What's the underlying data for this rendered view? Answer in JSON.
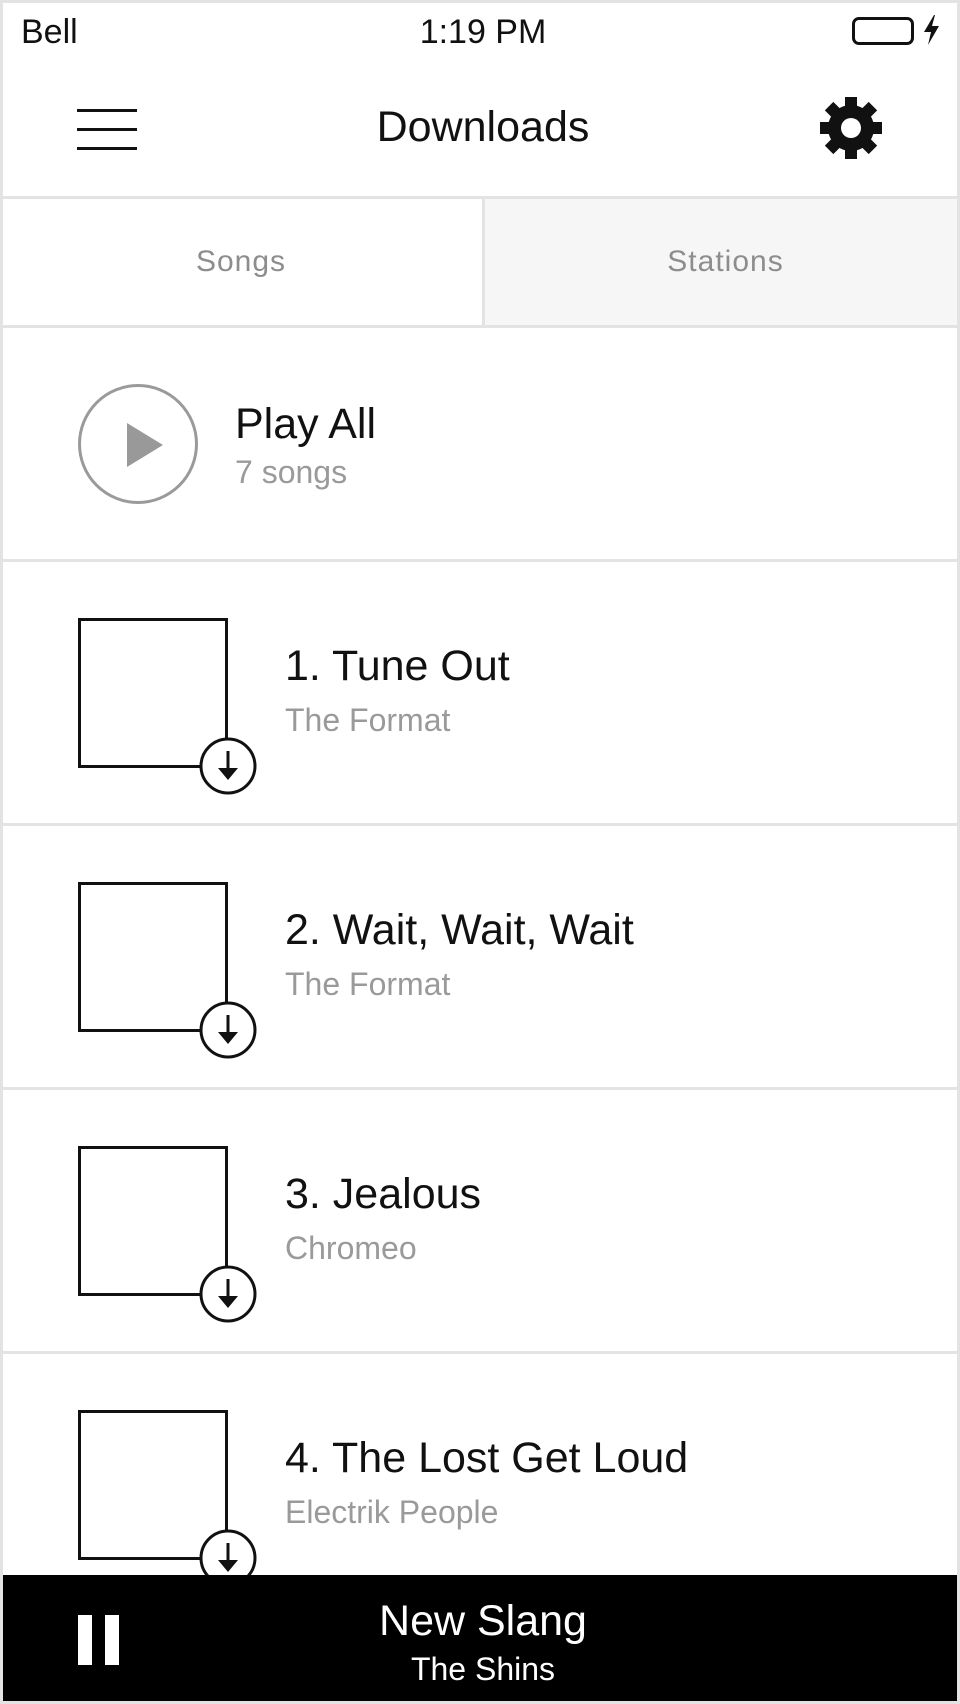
{
  "status_bar": {
    "carrier": "Bell",
    "time": "1:19 PM"
  },
  "header": {
    "title": "Downloads"
  },
  "tabs": [
    {
      "label": "Songs"
    },
    {
      "label": "Stations"
    }
  ],
  "play_all": {
    "label": "Play All",
    "count": "7 songs"
  },
  "songs": [
    {
      "title": "1. Tune Out",
      "artist": "The Format"
    },
    {
      "title": "2. Wait, Wait, Wait",
      "artist": "The Format"
    },
    {
      "title": "3. Jealous",
      "artist": "Chromeo"
    },
    {
      "title": "4. The Lost Get Loud",
      "artist": "Electrik People"
    }
  ],
  "now_playing": {
    "title": "New Slang",
    "artist": "The Shins"
  },
  "icons": {
    "menu": "hamburger-icon",
    "settings": "gear-icon",
    "play": "play-icon",
    "download": "download-icon",
    "pause": "pause-icon",
    "battery": "battery-icon",
    "charging": "charging-bolt-icon"
  },
  "colors": {
    "primary_text": "#111111",
    "secondary_text": "#9a9a9a",
    "player_bg": "#000000"
  }
}
